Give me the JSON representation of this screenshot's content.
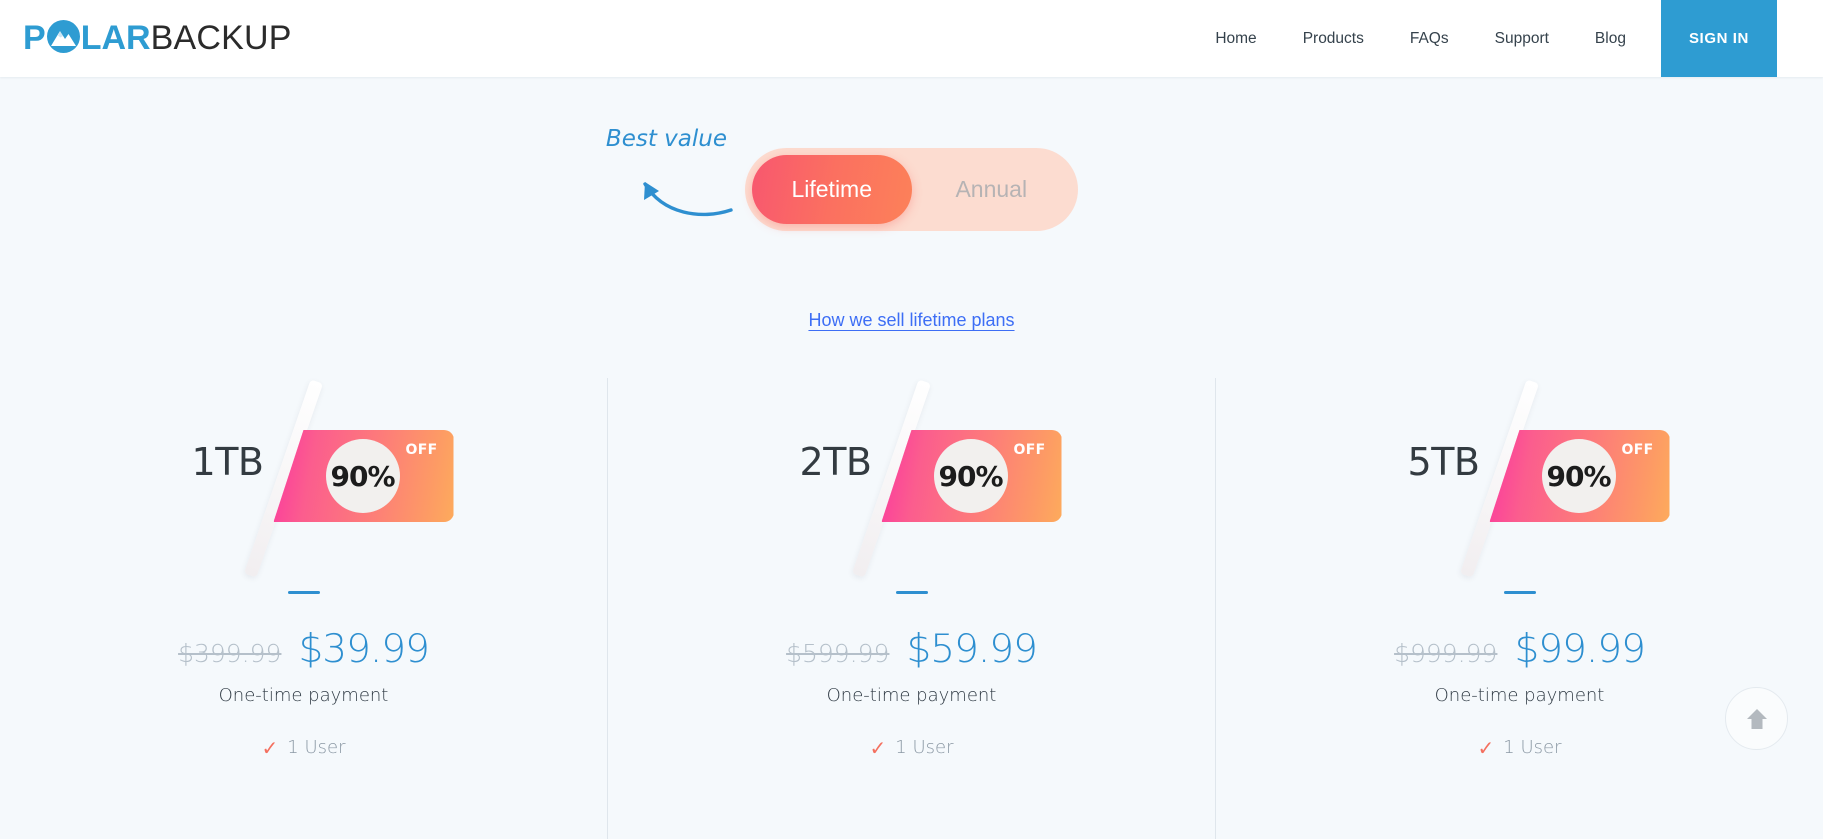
{
  "brand": {
    "logo_part1": "P",
    "logo_icon": "mountain-circle-icon",
    "logo_part2": "LAR",
    "logo_part3": "BACKUP",
    "logo_color": "#2e9cd2"
  },
  "nav": {
    "items": [
      {
        "label": "Home"
      },
      {
        "label": "Products"
      },
      {
        "label": "FAQs"
      },
      {
        "label": "Support"
      },
      {
        "label": "Blog"
      }
    ],
    "signin_label": "SIGN IN",
    "signin_color": "#2e9cd2"
  },
  "toggle": {
    "annotation": "Best value",
    "annotation_color": "#2e8fd0",
    "options": [
      {
        "label": "Lifetime",
        "active": true
      },
      {
        "label": "Annual",
        "active": false
      }
    ],
    "active_color": "#fb6a63",
    "track_color": "#fcdcd0"
  },
  "link": {
    "label": "How we sell lifetime plans",
    "color": "#3d6ef5"
  },
  "plans": [
    {
      "size": "1TB",
      "discount": "90%",
      "discount_suffix": "OFF",
      "price_old": "$399.99",
      "price_new": "$39.99",
      "payment_note": "One-time payment",
      "feature": "1 User"
    },
    {
      "size": "2TB",
      "discount": "90%",
      "discount_suffix": "OFF",
      "price_old": "$599.99",
      "price_new": "$59.99",
      "payment_note": "One-time payment",
      "feature": "1 User"
    },
    {
      "size": "5TB",
      "discount": "90%",
      "discount_suffix": "OFF",
      "price_old": "$999.99",
      "price_new": "$99.99",
      "payment_note": "One-time payment",
      "feature": "1 User"
    }
  ],
  "scroll_top": {
    "icon": "arrow-up-icon"
  },
  "colors": {
    "page_background": "#f5f9fc",
    "price_accent": "#2e8fd0",
    "check_accent": "#f4705f"
  }
}
